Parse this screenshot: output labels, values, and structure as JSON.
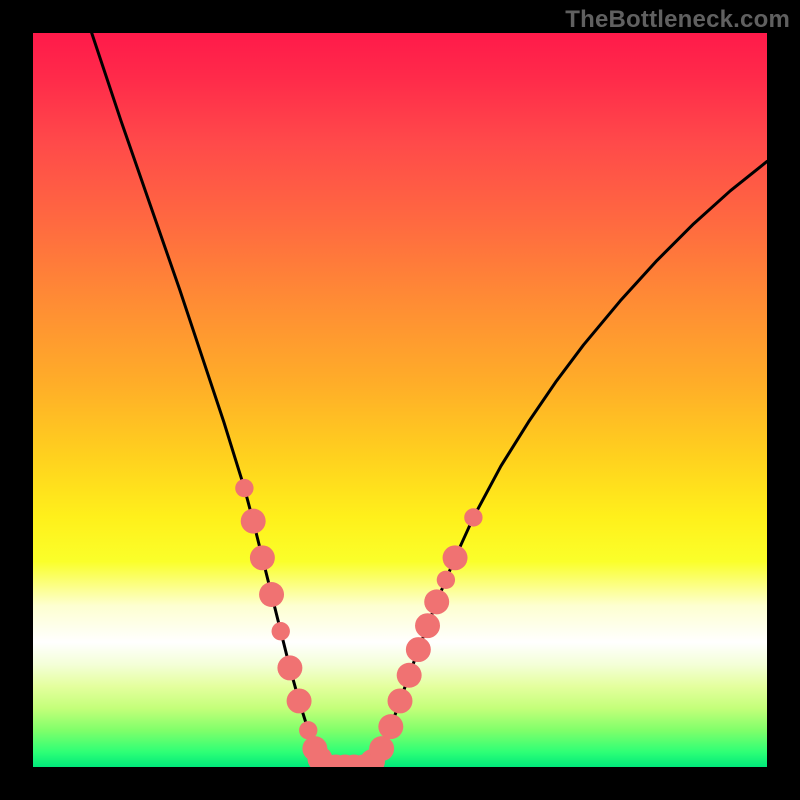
{
  "watermark": "TheBottleneck.com",
  "colors": {
    "curve": "#000000",
    "dot_fill": "#f07272",
    "dot_stroke": "#f07272",
    "frame": "#000000"
  },
  "chart_data": {
    "type": "line",
    "title": "",
    "xlabel": "",
    "ylabel": "",
    "xlim": [
      0,
      100
    ],
    "ylim": [
      0,
      100
    ],
    "grid": false,
    "legend": false,
    "series": [
      {
        "name": "curve",
        "x": [
          8,
          12,
          16,
          20,
          23,
          26,
          28.8,
          30,
          31.25,
          32.5,
          33.75,
          35,
          36.25,
          37.5,
          38.4,
          39.1,
          40,
          41.25,
          42.5,
          43.75,
          45,
          46.25,
          47.5,
          48.75,
          50,
          52.5,
          55,
          57.5,
          60,
          63.75,
          67.5,
          71.25,
          75,
          80,
          85,
          90,
          95,
          100
        ],
        "y": [
          100,
          88,
          76.5,
          65,
          56,
          47,
          38,
          33.5,
          28.5,
          23.5,
          18.5,
          13.5,
          9,
          5,
          2.5,
          1.1,
          0,
          0,
          0,
          0,
          0,
          0.75,
          2.5,
          5.5,
          9,
          16,
          22.5,
          28.5,
          34,
          41,
          47,
          52.5,
          57.5,
          63.5,
          69,
          74,
          78.5,
          82.5
        ]
      }
    ],
    "markers": {
      "name": "dots",
      "note": "salmon circular markers overlaid near the valley",
      "points": [
        {
          "x": 28.8,
          "y": 38.0,
          "r": 1.25
        },
        {
          "x": 30.0,
          "y": 33.5,
          "r": 1.7
        },
        {
          "x": 31.25,
          "y": 28.5,
          "r": 1.7
        },
        {
          "x": 32.5,
          "y": 23.5,
          "r": 1.7
        },
        {
          "x": 33.75,
          "y": 18.5,
          "r": 1.25
        },
        {
          "x": 35.0,
          "y": 13.5,
          "r": 1.7
        },
        {
          "x": 36.25,
          "y": 9.0,
          "r": 1.7
        },
        {
          "x": 37.5,
          "y": 5.0,
          "r": 1.25
        },
        {
          "x": 38.4,
          "y": 2.5,
          "r": 1.7
        },
        {
          "x": 39.1,
          "y": 1.1,
          "r": 1.7
        },
        {
          "x": 40.0,
          "y": 0.0,
          "r": 1.7
        },
        {
          "x": 41.25,
          "y": 0.0,
          "r": 1.7
        },
        {
          "x": 42.5,
          "y": 0.0,
          "r": 1.7
        },
        {
          "x": 43.75,
          "y": 0.0,
          "r": 1.7
        },
        {
          "x": 45.0,
          "y": 0.0,
          "r": 1.7
        },
        {
          "x": 46.25,
          "y": 0.75,
          "r": 1.7
        },
        {
          "x": 47.5,
          "y": 2.5,
          "r": 1.7
        },
        {
          "x": 48.75,
          "y": 5.5,
          "r": 1.7
        },
        {
          "x": 50.0,
          "y": 9.0,
          "r": 1.7
        },
        {
          "x": 51.25,
          "y": 12.5,
          "r": 1.7
        },
        {
          "x": 52.5,
          "y": 16.0,
          "r": 1.7
        },
        {
          "x": 53.75,
          "y": 19.25,
          "r": 1.7
        },
        {
          "x": 55.0,
          "y": 22.5,
          "r": 1.7
        },
        {
          "x": 56.25,
          "y": 25.5,
          "r": 1.25
        },
        {
          "x": 57.5,
          "y": 28.5,
          "r": 1.7
        },
        {
          "x": 60.0,
          "y": 34.0,
          "r": 1.25
        }
      ]
    }
  }
}
